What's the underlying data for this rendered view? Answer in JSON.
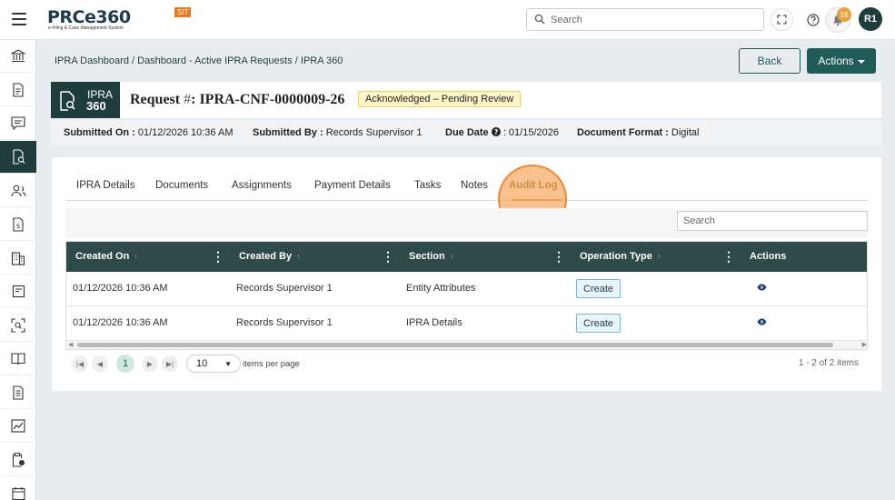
{
  "app": {
    "logo_text_main": "PRCe360",
    "logo_subtext": "e-Filing & Case Management System",
    "env_badge": "SIT"
  },
  "topbar": {
    "search_placeholder": "Search",
    "notification_count": "16",
    "user_initials": "R1"
  },
  "sidebar": {
    "items": [
      "dashboard-icon",
      "document-icon",
      "comments-icon",
      "ipra-icon",
      "users-icon",
      "payment-icon",
      "building-icon",
      "task-icon",
      "scan-icon",
      "book-icon",
      "form-icon",
      "chart-icon",
      "clipboard-icon",
      "calendar-icon"
    ],
    "active_index": 3
  },
  "breadcrumb": {
    "items": [
      "IPRA Dashboard",
      "Dashboard - Active IPRA Requests",
      "IPRA 360"
    ],
    "separator": "/"
  },
  "header_actions": {
    "back_label": "Back",
    "actions_label": "Actions"
  },
  "request": {
    "logo_line1": "IPRA",
    "logo_line2": "360",
    "title_prefix": "Request",
    "title_hash": "#",
    "title_id": ": IPRA-CNF-0000009-26",
    "status": "Acknowledged – Pending Review"
  },
  "meta": {
    "submitted_on_label": "Submitted On :",
    "submitted_on_value": "01/12/2026 10:36 AM",
    "submitted_by_label": "Submitted By :",
    "submitted_by_value": "Records Supervisor 1",
    "due_date_label": "Due Date",
    "due_date_value": ": 01/15/2026",
    "format_label": "Document Format :",
    "format_value": "Digital"
  },
  "tabs": [
    "IPRA Details",
    "Documents",
    "Assignments",
    "Payment Details",
    "Tasks",
    "Notes",
    "Audit Log"
  ],
  "active_tab": "Audit Log",
  "grid": {
    "search_placeholder": "Search",
    "columns": [
      "Created On",
      "Created By",
      "Section",
      "Operation Type",
      "Actions"
    ],
    "rows": [
      {
        "created_on": "01/12/2026 10:36 AM",
        "created_by": "Records Supervisor 1",
        "section": "Entity Attributes",
        "operation": "Create"
      },
      {
        "created_on": "01/12/2026 10:36 AM",
        "created_by": "Records Supervisor 1",
        "section": "IPRA Details",
        "operation": "Create"
      }
    ]
  },
  "pager": {
    "current_page": "1",
    "page_size": "10",
    "items_per_page_label": "items per page",
    "info": "1 - 2 of 2 items"
  },
  "colors": {
    "brand_dark": "#1f3d3a",
    "accent": "#1f5b57",
    "grid_header": "#2e4a49",
    "status_bg": "#fff6c7",
    "active_tab": "#8a6a3a",
    "notification": "#e8a23c"
  }
}
